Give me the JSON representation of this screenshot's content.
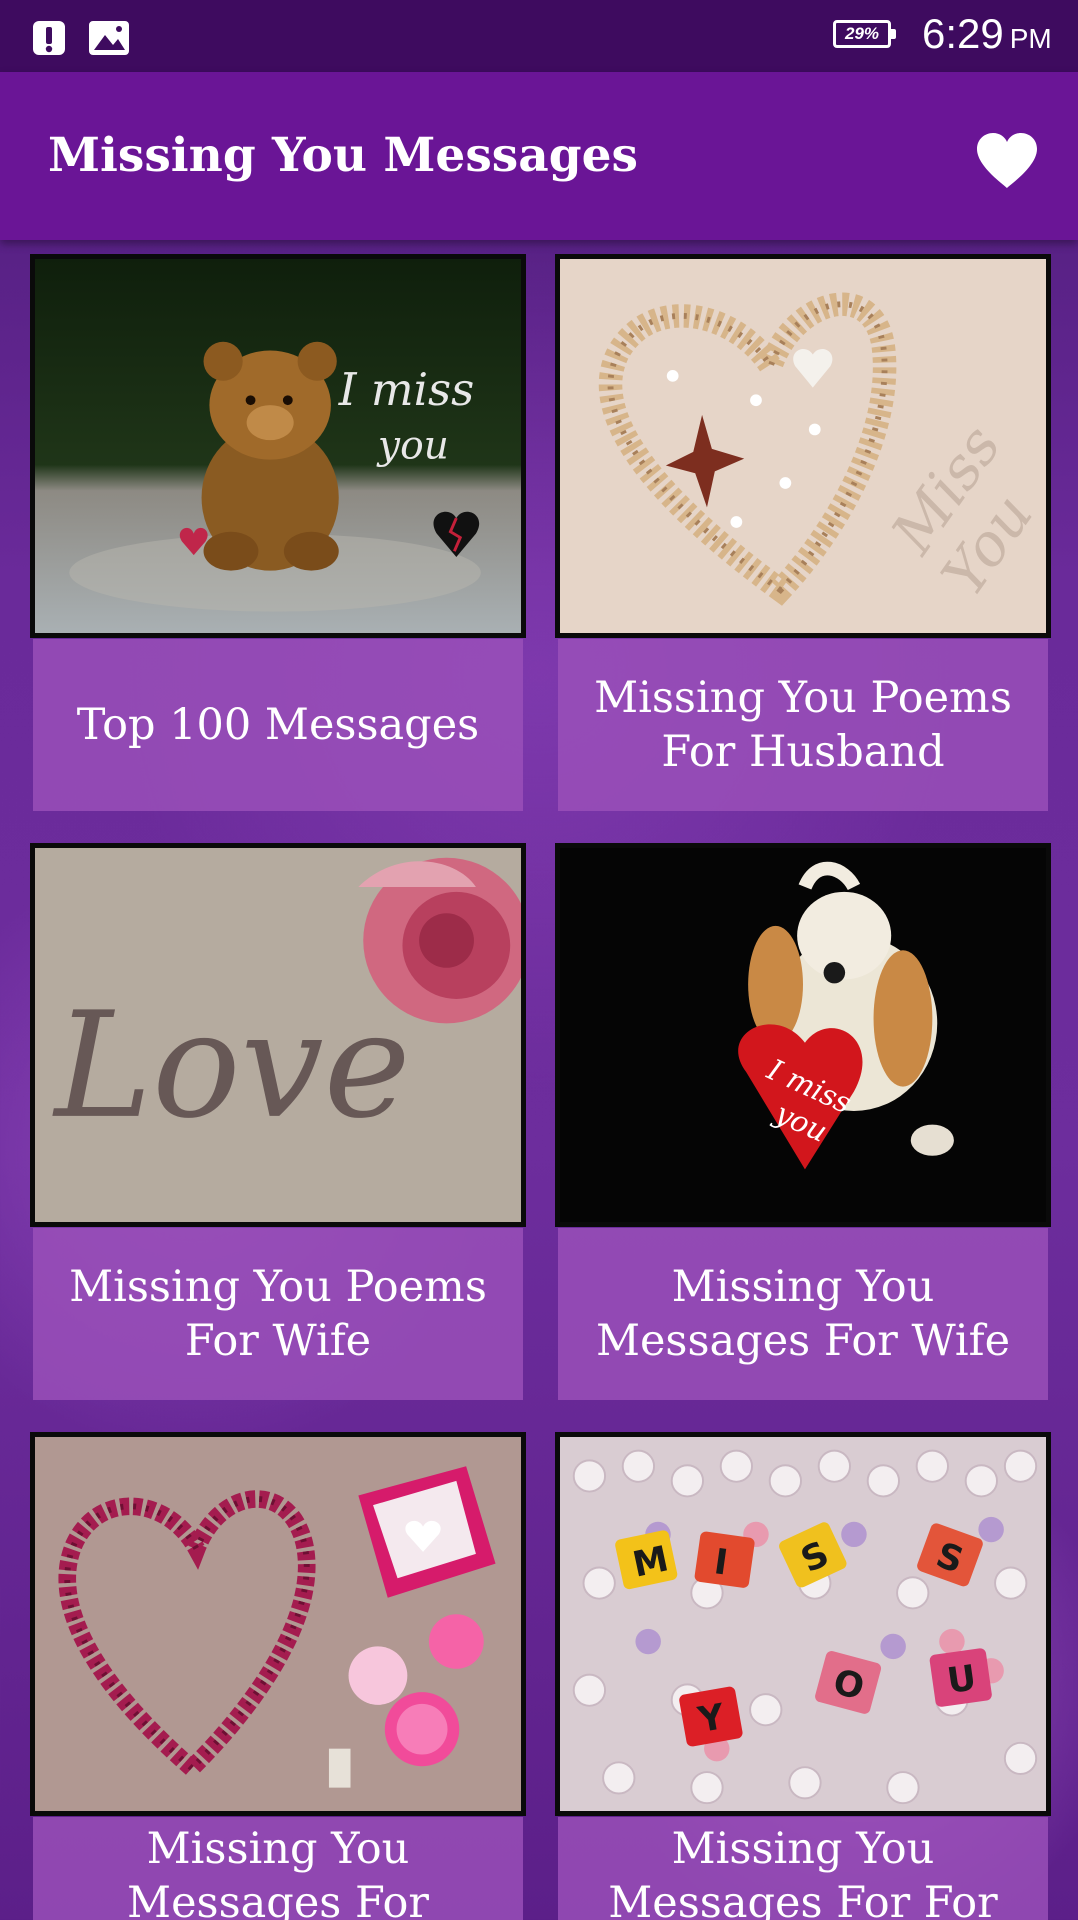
{
  "status_bar": {
    "battery": "29%",
    "time": "6:29",
    "ampm": "PM",
    "icons": [
      "alert-icon",
      "image-icon"
    ]
  },
  "app_bar": {
    "title": "Missing You Messages",
    "favorite_icon": "heart-icon"
  },
  "categories": [
    {
      "label": "Top 100 Messages",
      "image": "teddy bear with \"I miss you\" text and broken heart"
    },
    {
      "label": "Missing You Poems For Husband",
      "image": "seashell heart on sand with \"Miss You\" written"
    },
    {
      "label": "Missing You Poems For Wife",
      "image": "\"Love\" written on fabric with pink rose"
    },
    {
      "label": "Missing You Messages For Wife",
      "image": "plush puppy holding red \"I miss you\" heart"
    },
    {
      "label": "Missing You Messages For Husband",
      "image": "rose petal heart on sand with pink envelope"
    },
    {
      "label": "Missing You Messages For For Boyfriend",
      "image": "pearls with letter beads spelling MISS YOU"
    }
  ],
  "colors": {
    "status_bar": "#3e0b5f",
    "app_bar": "#6a1596",
    "label_background": "#9b50b9",
    "text": "#ffffff"
  }
}
